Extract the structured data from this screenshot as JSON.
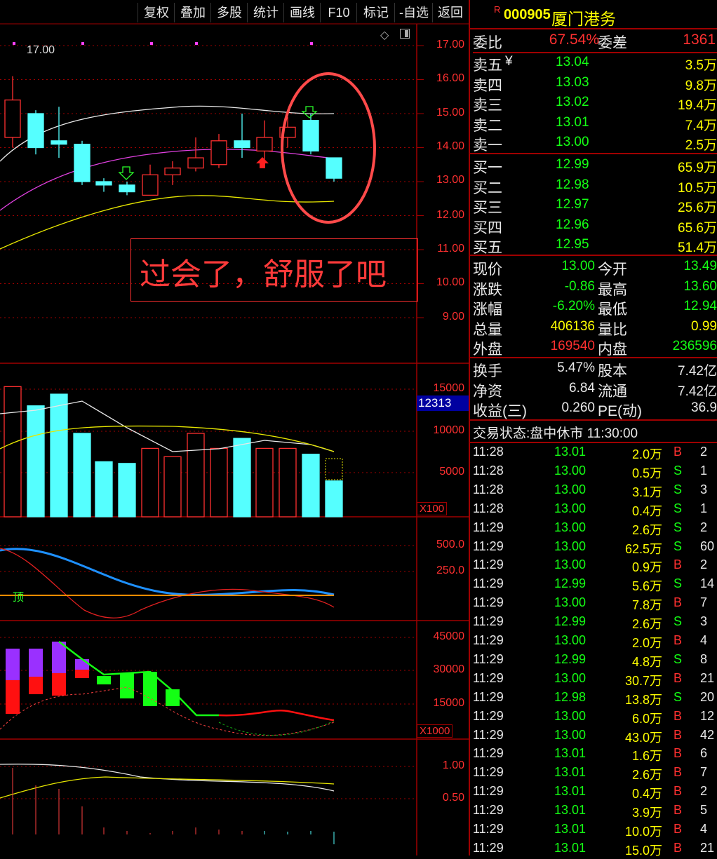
{
  "toolbar": [
    {
      "label": "复权"
    },
    {
      "label": "叠加"
    },
    {
      "label": "多股"
    },
    {
      "label": "统计"
    },
    {
      "label": "画线"
    },
    {
      "label": "F10"
    },
    {
      "label": "标记"
    },
    {
      "label": "-自选"
    },
    {
      "label": "返回"
    }
  ],
  "chart": {
    "high_label": "17.00",
    "annotation": "过会了，舒服了吧",
    "price_ticks": [
      "17.00",
      "16.00",
      "15.00",
      "14.00",
      "13.00",
      "12.00",
      "11.00",
      "10.00",
      "9.00"
    ],
    "vol_ticks": [
      "15000",
      "10000",
      "5000"
    ],
    "vol_current": "12313",
    "vol_unit": "X100",
    "ind1_ticks": [
      "500.0",
      "250.0"
    ],
    "ind1_label": "顶",
    "ind2_ticks": [
      "45000",
      "30000",
      "15000"
    ],
    "ind2_unit": "X1000",
    "ind3_ticks": [
      "1.00",
      "0.50"
    ]
  },
  "chart_data": {
    "type": "candlestick",
    "candles": [
      {
        "open": 14.3,
        "close": 15.4,
        "high": 16.1,
        "low": 14.0
      },
      {
        "open": 15.0,
        "close": 14.0,
        "high": 15.1,
        "low": 13.8
      },
      {
        "open": 14.2,
        "close": 14.1,
        "high": 15.2,
        "low": 13.7
      },
      {
        "open": 14.1,
        "close": 13.0,
        "high": 14.2,
        "low": 12.9
      },
      {
        "open": 13.0,
        "close": 12.9,
        "high": 13.1,
        "low": 12.7
      },
      {
        "open": 12.9,
        "close": 12.7,
        "high": 13.0,
        "low": 12.6
      },
      {
        "open": 12.6,
        "close": 13.2,
        "high": 13.5,
        "low": 12.6
      },
      {
        "open": 13.2,
        "close": 13.4,
        "high": 13.6,
        "low": 12.9
      },
      {
        "open": 13.4,
        "close": 13.7,
        "high": 14.3,
        "low": 13.3
      },
      {
        "open": 13.5,
        "close": 14.2,
        "high": 14.4,
        "low": 13.4
      },
      {
        "open": 14.2,
        "close": 14.0,
        "high": 15.0,
        "low": 13.7
      },
      {
        "open": 13.9,
        "close": 14.3,
        "high": 14.8,
        "low": 13.6
      },
      {
        "open": 14.3,
        "close": 14.6,
        "high": 14.9,
        "low": 14.0
      },
      {
        "open": 14.8,
        "close": 13.9,
        "high": 15.0,
        "low": 13.8
      },
      {
        "open": 13.7,
        "close": 13.1,
        "high": 13.7,
        "low": 13.0
      }
    ],
    "volumes": [
      15600,
      13300,
      14700,
      10000,
      6600,
      6400,
      8200,
      7200,
      10000,
      8200,
      9400,
      8200,
      8200,
      7500,
      4300
    ],
    "ylim": [
      8.5,
      17.5
    ]
  },
  "quote": {
    "flag": "R",
    "code": "000905",
    "name": "厦门港务",
    "weibi_label": "委比",
    "weibi": "67.54%",
    "weicha_label": "委差",
    "weicha": "1361",
    "sells": [
      {
        "label": "卖五",
        "mark": "¥",
        "price": "13.04",
        "vol": "3.5万"
      },
      {
        "label": "卖四",
        "mark": "",
        "price": "13.03",
        "vol": "9.8万"
      },
      {
        "label": "卖三",
        "mark": "",
        "price": "13.02",
        "vol": "19.4万"
      },
      {
        "label": "卖二",
        "mark": "",
        "price": "13.01",
        "vol": "7.4万"
      },
      {
        "label": "卖一",
        "mark": "",
        "price": "13.00",
        "vol": "2.5万"
      }
    ],
    "buys": [
      {
        "label": "买一",
        "price": "12.99",
        "vol": "65.9万"
      },
      {
        "label": "买二",
        "price": "12.98",
        "vol": "10.5万"
      },
      {
        "label": "买三",
        "price": "12.97",
        "vol": "25.6万"
      },
      {
        "label": "买四",
        "price": "12.96",
        "vol": "65.6万"
      },
      {
        "label": "买五",
        "price": "12.95",
        "vol": "51.4万"
      }
    ],
    "stats": [
      {
        "l1": "现价",
        "v1": "13.00",
        "l2": "今开",
        "v2": "13.49"
      },
      {
        "l1": "涨跌",
        "v1": "-0.86",
        "l2": "最高",
        "v2": "13.60"
      },
      {
        "l1": "涨幅",
        "v1": "-6.20%",
        "l2": "最低",
        "v2": "12.94"
      },
      {
        "l1": "总量",
        "v1": "406136",
        "l2": "量比",
        "v2": "0.99"
      },
      {
        "l1": "外盘",
        "v1": "169540",
        "l2": "内盘",
        "v2": "236596"
      }
    ],
    "stats2": [
      {
        "l1": "换手",
        "v1": "5.47%",
        "l2": "股本",
        "v2": "7.42亿"
      },
      {
        "l1": "净资",
        "v1": "6.84",
        "l2": "流通",
        "v2": "7.42亿"
      },
      {
        "l1": "收益(三)",
        "v1": "0.260",
        "l2": "PE(动)",
        "v2": "36.9"
      }
    ],
    "status_label": "交易状态:",
    "status": "盘中休市",
    "status_time": "11:30:00"
  },
  "trades": [
    {
      "t": "11:28",
      "p": "13.01",
      "v": "2.0万",
      "s": "B",
      "n": "2"
    },
    {
      "t": "11:28",
      "p": "13.00",
      "v": "0.5万",
      "s": "S",
      "n": "1"
    },
    {
      "t": "11:28",
      "p": "13.00",
      "v": "3.1万",
      "s": "S",
      "n": "3"
    },
    {
      "t": "11:28",
      "p": "13.00",
      "v": "0.4万",
      "s": "S",
      "n": "1"
    },
    {
      "t": "11:29",
      "p": "13.00",
      "v": "2.6万",
      "s": "S",
      "n": "2"
    },
    {
      "t": "11:29",
      "p": "13.00",
      "v": "62.5万",
      "s": "S",
      "n": "60"
    },
    {
      "t": "11:29",
      "p": "13.00",
      "v": "0.9万",
      "s": "B",
      "n": "2"
    },
    {
      "t": "11:29",
      "p": "12.99",
      "v": "5.6万",
      "s": "S",
      "n": "14"
    },
    {
      "t": "11:29",
      "p": "13.00",
      "v": "7.8万",
      "s": "B",
      "n": "7"
    },
    {
      "t": "11:29",
      "p": "12.99",
      "v": "2.6万",
      "s": "S",
      "n": "3"
    },
    {
      "t": "11:29",
      "p": "13.00",
      "v": "2.0万",
      "s": "B",
      "n": "4"
    },
    {
      "t": "11:29",
      "p": "12.99",
      "v": "4.8万",
      "s": "S",
      "n": "8"
    },
    {
      "t": "11:29",
      "p": "13.00",
      "v": "30.7万",
      "s": "B",
      "n": "21"
    },
    {
      "t": "11:29",
      "p": "12.98",
      "v": "13.8万",
      "s": "S",
      "n": "20"
    },
    {
      "t": "11:29",
      "p": "13.00",
      "v": "6.0万",
      "s": "B",
      "n": "12"
    },
    {
      "t": "11:29",
      "p": "13.00",
      "v": "43.0万",
      "s": "B",
      "n": "42"
    },
    {
      "t": "11:29",
      "p": "13.01",
      "v": "1.6万",
      "s": "B",
      "n": "6"
    },
    {
      "t": "11:29",
      "p": "13.01",
      "v": "2.6万",
      "s": "B",
      "n": "7"
    },
    {
      "t": "11:29",
      "p": "13.01",
      "v": "0.4万",
      "s": "B",
      "n": "2"
    },
    {
      "t": "11:29",
      "p": "13.01",
      "v": "3.9万",
      "s": "B",
      "n": "5"
    },
    {
      "t": "11:29",
      "p": "13.01",
      "v": "10.0万",
      "s": "B",
      "n": "4"
    },
    {
      "t": "11:29",
      "p": "13.01",
      "v": "15.0万",
      "s": "B",
      "n": "21"
    }
  ],
  "colors": {
    "up": "#ff3030",
    "down": "#55ffff",
    "grid": "#a00000"
  }
}
